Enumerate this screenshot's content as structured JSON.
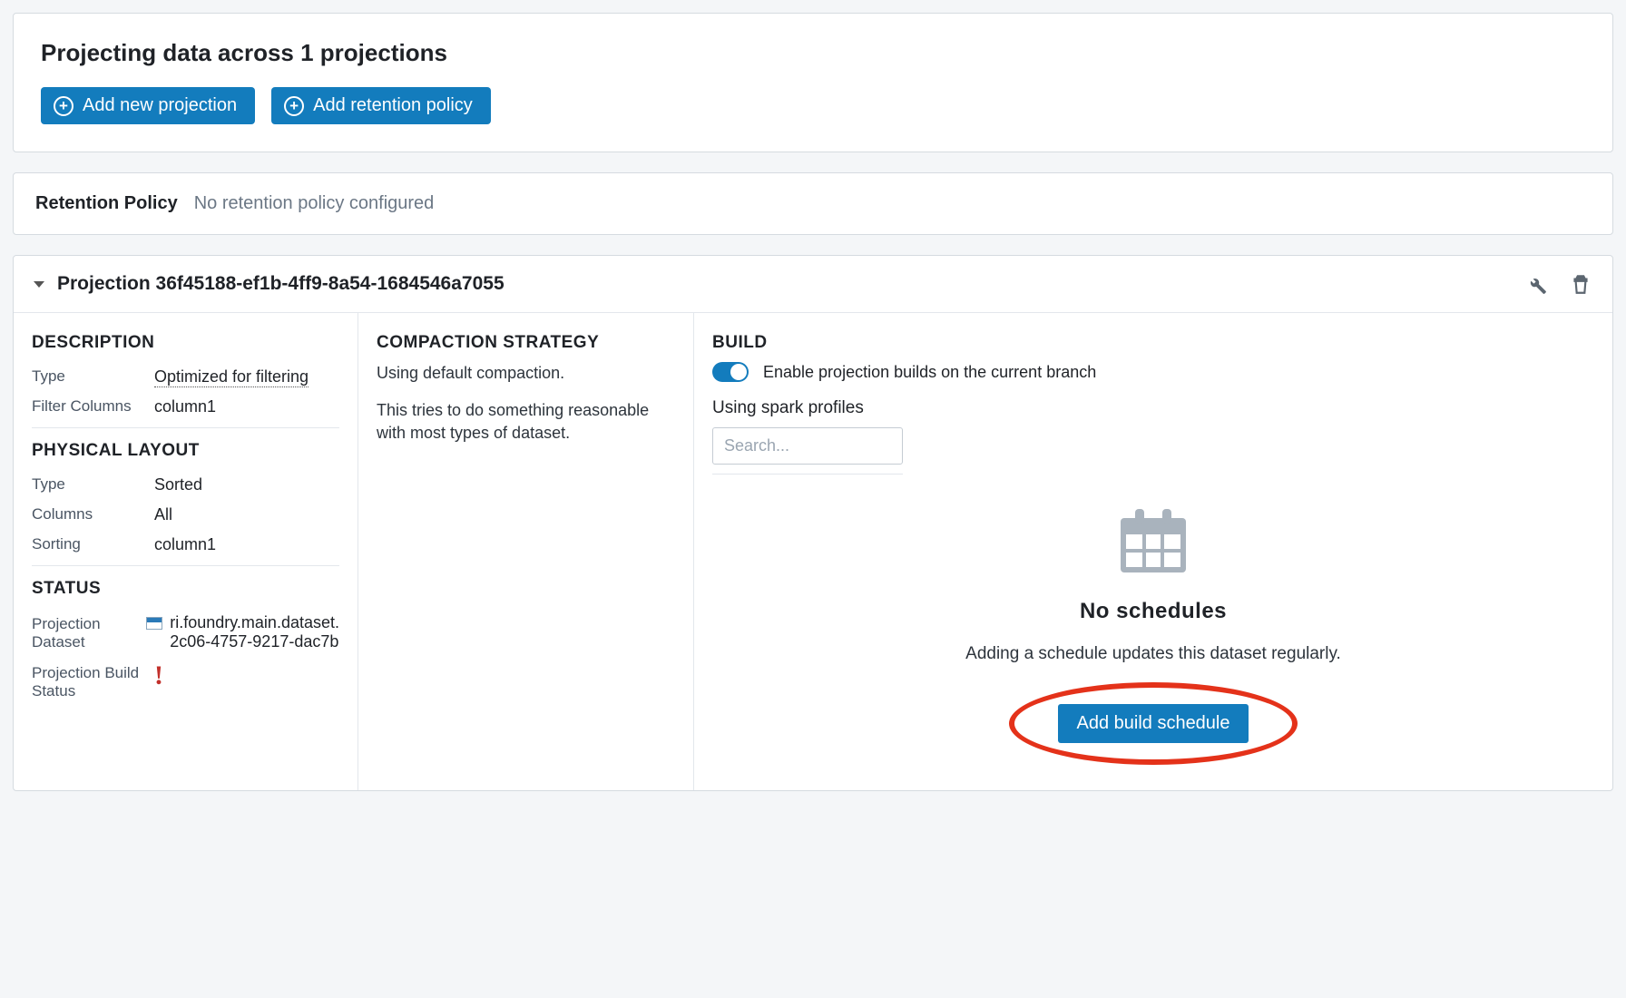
{
  "top": {
    "title_prefix": "Projecting data across ",
    "count": "1",
    "title_suffix": " projections",
    "add_projection_label": "Add new projection",
    "add_retention_label": "Add retention policy"
  },
  "retention": {
    "label": "Retention Policy",
    "value": "No retention policy configured"
  },
  "projection": {
    "title": "Projection 36f45188-ef1b-4ff9-8a54-1684546a7055",
    "description": {
      "heading": "DESCRIPTION",
      "type_label": "Type",
      "type_value": "Optimized for filtering",
      "filter_label": "Filter Columns",
      "filter_value": "column1"
    },
    "physical": {
      "heading": "PHYSICAL LAYOUT",
      "type_label": "Type",
      "type_value": "Sorted",
      "columns_label": "Columns",
      "columns_value": "All",
      "sorting_label": "Sorting",
      "sorting_value": "column1"
    },
    "status": {
      "heading": "STATUS",
      "dataset_label": "Projection Dataset",
      "dataset_value": "ri.foundry.main.dataset.\n2c06-4757-9217-dac7b",
      "build_status_label": "Projection Build Status"
    },
    "compaction": {
      "heading": "COMPACTION STRATEGY",
      "line1": "Using default compaction.",
      "line2": "This tries to do something reasonable with most types of dataset."
    },
    "build": {
      "heading": "BUILD",
      "toggle_label": "Enable projection builds on the current branch",
      "spark_label": "Using spark profiles",
      "search_placeholder": "Search...",
      "no_schedules_title": "No schedules",
      "no_schedules_sub": "Adding a schedule updates this dataset regularly.",
      "add_schedule_label": "Add build schedule"
    }
  }
}
